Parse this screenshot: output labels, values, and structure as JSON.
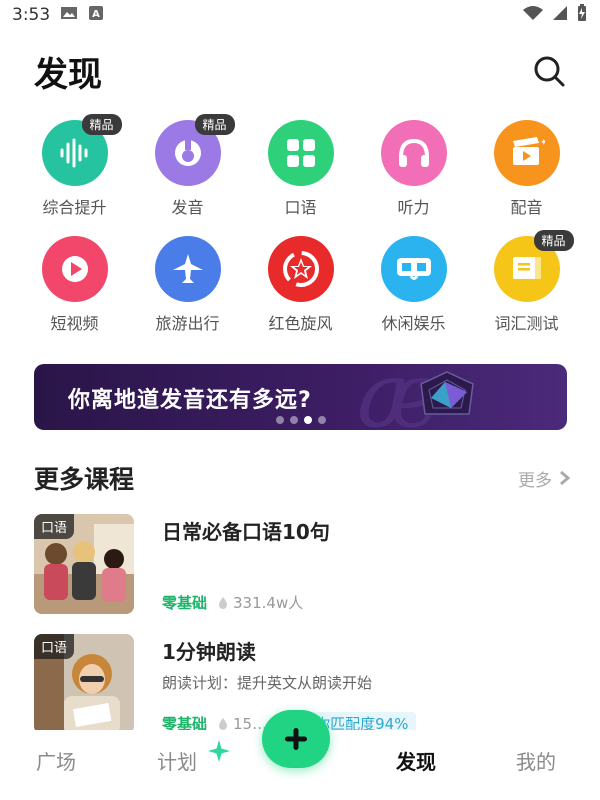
{
  "status_bar": {
    "time": "3:53"
  },
  "header": {
    "title": "发现"
  },
  "categories": [
    {
      "label": "综合提升",
      "badge": "精品",
      "color": "#26c3a0",
      "icon": "waveform-icon"
    },
    {
      "label": "发音",
      "badge": "精品",
      "color": "#9c7ae6",
      "icon": "pronunciation-icon"
    },
    {
      "label": "口语",
      "badge": "",
      "color": "#2ed07a",
      "icon": "grid-icon"
    },
    {
      "label": "听力",
      "badge": "",
      "color": "#f26fb7",
      "icon": "headphones-icon"
    },
    {
      "label": "配音",
      "badge": "",
      "color": "#f7941d",
      "icon": "clapperboard-icon"
    },
    {
      "label": "短视频",
      "badge": "",
      "color": "#f2476a",
      "icon": "play-bubble-icon"
    },
    {
      "label": "旅游出行",
      "badge": "",
      "color": "#4a7de8",
      "icon": "airplane-icon"
    },
    {
      "label": "红色旋风",
      "badge": "",
      "color": "#e82a2a",
      "icon": "red-star-icon"
    },
    {
      "label": "休闲娱乐",
      "badge": "",
      "color": "#2ab3ee",
      "icon": "vr-glasses-icon"
    },
    {
      "label": "词汇测试",
      "badge": "精品",
      "color": "#f5c518",
      "icon": "book-icon"
    }
  ],
  "banner": {
    "text": "你离地道发音还有多远?",
    "active_dot": 2,
    "dot_count": 4
  },
  "more_courses": {
    "title": "更多课程",
    "more_label": "更多",
    "courses": [
      {
        "tag": "口语",
        "title": "日常必备口语10句",
        "desc": "",
        "level": "零基础",
        "learners": "331.4w人",
        "match": ""
      },
      {
        "tag": "口语",
        "title": "1分钟朗读",
        "desc": "朗读计划：提升英文从朗读开始",
        "level": "零基础",
        "learners": "15…人",
        "match": "与你匹配度94%"
      }
    ]
  },
  "bottom_nav": {
    "tabs": [
      "广场",
      "计划",
      "发现",
      "我的"
    ],
    "active": "发现",
    "fab_icon": "plus-icon"
  }
}
